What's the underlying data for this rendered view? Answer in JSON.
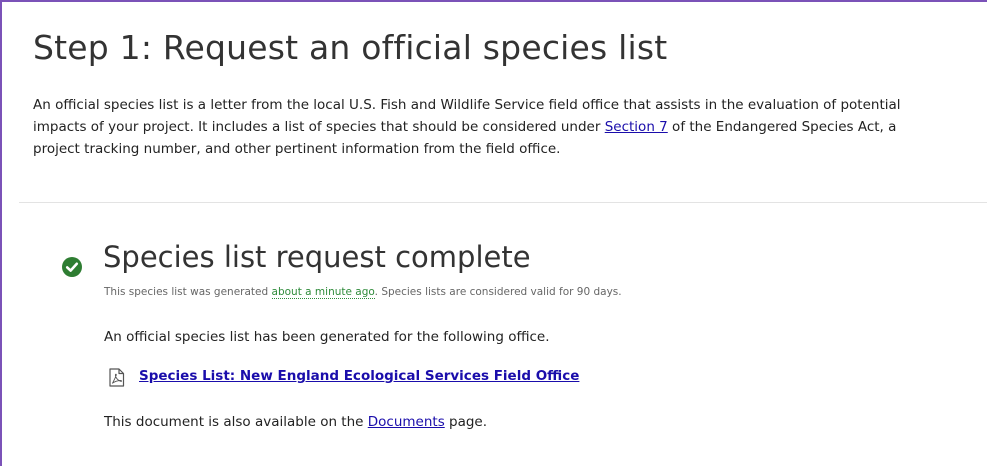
{
  "step": {
    "title": "Step 1: Request an official species list"
  },
  "intro": {
    "text_before_link": "An official species list is a letter from the local U.S. Fish and Wildlife Service field office that assists in the evaluation of potential impacts of your project. It includes a list of species that should be considered under ",
    "link_label": "Section 7",
    "text_after_link": " of the Endangered Species Act, a project tracking number, and other pertinent information from the field office."
  },
  "status": {
    "icon": "check-circle-icon",
    "title": "Species list request complete",
    "note_before": "This species list was generated ",
    "relative_time": "about a minute ago",
    "note_after": ". Species lists are considered valid for 90 days.",
    "generated_text": "An official species list has been generated for the following office.",
    "document_icon": "pdf-file-icon",
    "document_link": "Species List: New England Ecological Services Field Office",
    "documents_before": "This document is also available on the ",
    "documents_link": "Documents",
    "documents_after": " page."
  },
  "colors": {
    "success_green": "#2e7d32",
    "link_blue": "#1a0dab",
    "frame_purple": "#7b52b8",
    "timestamp_green": "#2e8b3a"
  }
}
